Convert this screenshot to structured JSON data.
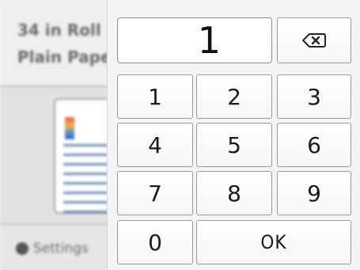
{
  "background": {
    "line1": "34 in Roll",
    "line2": "Plain Paper",
    "settings_label": "Settings"
  },
  "keypad": {
    "display_value": "1",
    "backspace_icon": "backspace-icon",
    "keys": [
      "1",
      "2",
      "3",
      "4",
      "5",
      "6",
      "7",
      "8",
      "9",
      "0"
    ],
    "ok_label": "OK"
  }
}
